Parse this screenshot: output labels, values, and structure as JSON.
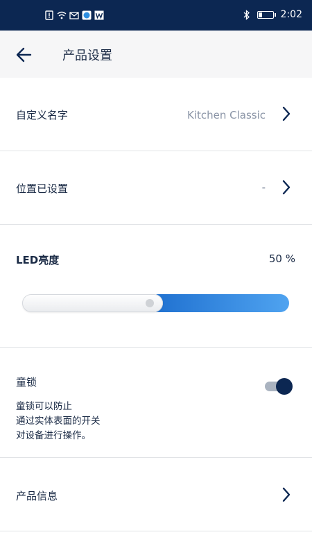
{
  "status_bar": {
    "time": "2:02",
    "left_icons": [
      "notification-icon",
      "wifi-icon",
      "mail-icon",
      "browser-icon",
      "app-w-icon"
    ],
    "right_icons": [
      "bluetooth-icon",
      "battery-icon"
    ]
  },
  "header": {
    "title": "产品设置",
    "back_icon": "arrow-left-icon"
  },
  "settings": {
    "custom_name": {
      "label": "自定义名字",
      "value": "Kitchen Classic"
    },
    "location": {
      "label": "位置已设置",
      "value": "-"
    },
    "led": {
      "label": "LED亮度",
      "value_text": "50 %",
      "level": 0.5
    },
    "child_lock": {
      "label": "童锁",
      "description": [
        "童锁可以防止",
        "通过实体表面的开关",
        "对设备进行操作。"
      ],
      "enabled": true
    },
    "product_info": {
      "label": "产品信息"
    }
  },
  "colors": {
    "status_bar_bg": "#0c2752",
    "accent": "#1e6fcf",
    "text_primary": "#1a2a45",
    "text_secondary": "#8a94a6"
  }
}
